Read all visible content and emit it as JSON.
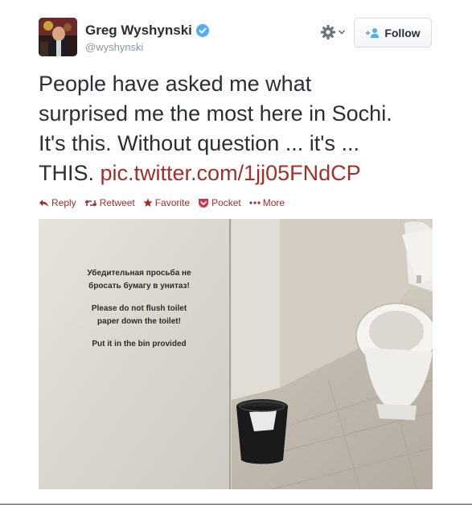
{
  "tweet": {
    "author_name": "Greg Wyshynski",
    "author_handle": "@wyshynski",
    "follow_label": "Follow",
    "text_lines": [
      "People have asked me what",
      "surprised me the most here in Sochi.",
      "It's this. Without question ... it's ...",
      "THIS. "
    ],
    "link_text": "pic.twitter.com/1jj05FNdCP",
    "actions": {
      "reply": "Reply",
      "retweet": "Retweet",
      "favorite": "Favorite",
      "pocket": "Pocket",
      "more": "More"
    }
  },
  "photo": {
    "sign_ru_1": "Убедительная просьба не",
    "sign_ru_2": "бросать бумагу в унитаз!",
    "sign_en_1": "Please do not flush toilet",
    "sign_en_2": "paper down the toilet!",
    "sign_en_3": "Put it in the bin provided"
  },
  "colors": {
    "link": "#a0312a",
    "verified": "#55acee",
    "text": "#292f33",
    "handle": "#8899a6"
  }
}
